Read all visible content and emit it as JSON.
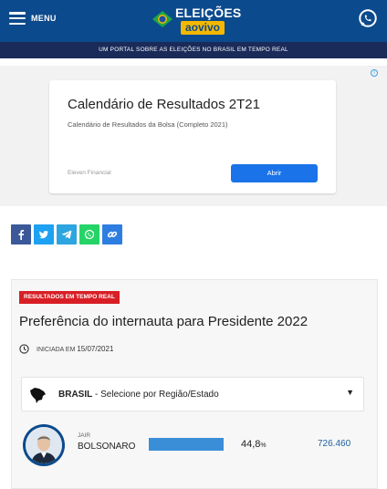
{
  "header": {
    "menu_label": "MENU",
    "logo_line1": "ELEIÇÕES",
    "logo_line2": "aovivo",
    "tagline": "UM PORTAL SOBRE AS ELEIÇÕES NO BRASIL EM TEMPO REAL",
    "brand_color": "#0b4a8c",
    "accent_color": "#f5b800"
  },
  "ad": {
    "title": "Calendário de Resultados 2T21",
    "description": "Calendário de Resultados da Bolsa (Completo 2021)",
    "advertiser": "Eleven Financial",
    "button_label": "Abrir",
    "button_color": "#1a73e8"
  },
  "share": [
    {
      "icon": "facebook-icon",
      "color": "#3b5998"
    },
    {
      "icon": "twitter-icon",
      "color": "#1da1f2"
    },
    {
      "icon": "telegram-icon",
      "color": "#2ca5e0"
    },
    {
      "icon": "whatsapp-icon",
      "color": "#25d366"
    },
    {
      "icon": "link-icon",
      "color": "#2d7ee0"
    }
  ],
  "poll": {
    "badge": "RESULTADOS EM TEMPO REAL",
    "badge_color": "#d81f26",
    "title": "Preferência do internauta para Presidente 2022",
    "started_prefix": "INICIADA EM",
    "started_date": "15/07/2021",
    "region_bold": "BRASIL",
    "region_rest": " - Selecione por Região/Estado",
    "candidates": [
      {
        "party": "JAIR",
        "name": "BOLSONARO",
        "percent_value": "44,8",
        "percent_sign": "%",
        "votes": "726.460",
        "bar_share": 0.448,
        "bar_color": "#3a8ed8"
      }
    ]
  }
}
